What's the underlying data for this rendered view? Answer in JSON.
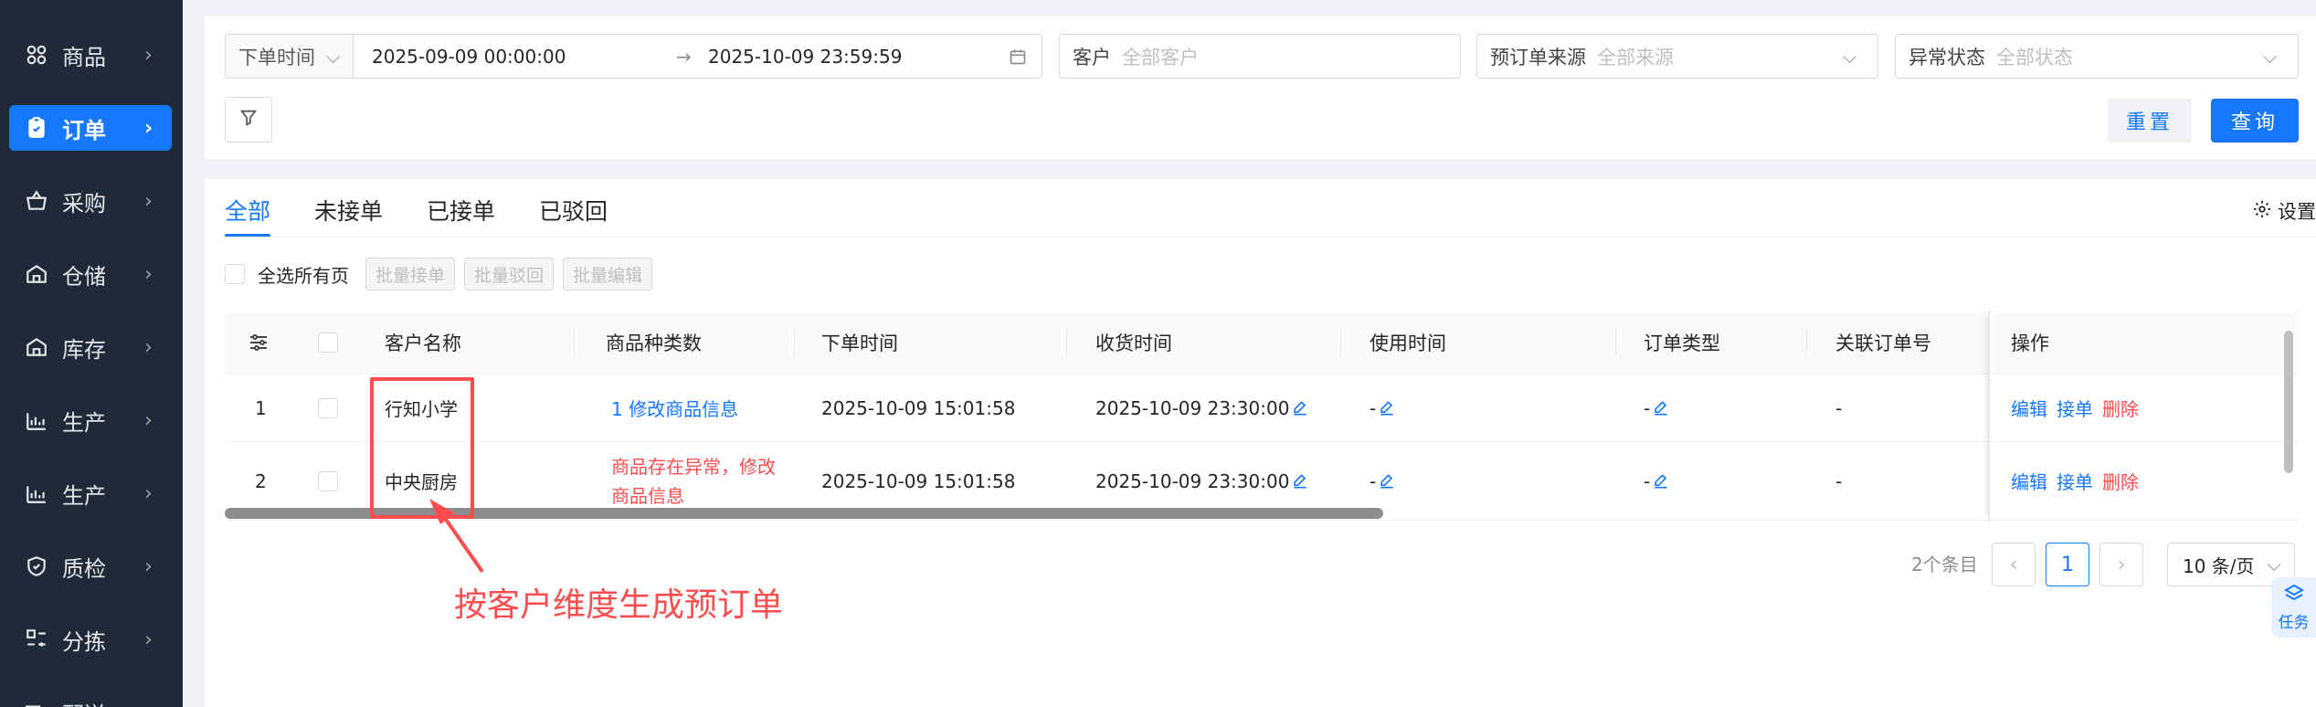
{
  "sidebar": {
    "items": [
      {
        "label": "商品",
        "icon": "grid-icon",
        "active": false
      },
      {
        "label": "订单",
        "icon": "clipboard-icon",
        "active": true
      },
      {
        "label": "采购",
        "icon": "basket-icon",
        "active": false
      },
      {
        "label": "仓储",
        "icon": "warehouse-icon",
        "active": false
      },
      {
        "label": "库存",
        "icon": "warehouse-icon",
        "active": false
      },
      {
        "label": "生产",
        "icon": "factory-icon",
        "active": false
      },
      {
        "label": "生产",
        "icon": "factory-icon",
        "active": false
      },
      {
        "label": "质检",
        "icon": "shield-icon",
        "active": false
      },
      {
        "label": "分拣",
        "icon": "sort-icon",
        "active": false
      },
      {
        "label": "配送",
        "icon": "truck-icon",
        "active": false
      }
    ]
  },
  "filters": {
    "date_type": "下单时间",
    "date_start": "2025-09-09 00:00:00",
    "date_end": "2025-10-09 23:59:59",
    "customer_label": "客户",
    "customer_placeholder": "全部客户",
    "source_label": "预订单来源",
    "source_placeholder": "全部来源",
    "status_label": "异常状态",
    "status_placeholder": "全部状态",
    "reset_label": "重置",
    "query_label": "查询"
  },
  "tabs": [
    "全部",
    "未接单",
    "已接单",
    "已驳回"
  ],
  "settings_label": "设置",
  "bulk": {
    "select_all_label": "全选所有页",
    "accept_label": "批量接单",
    "reject_label": "批量驳回",
    "edit_label": "批量编辑"
  },
  "table": {
    "columns": [
      "客户名称",
      "商品种类数",
      "下单时间",
      "收货时间",
      "使用时间",
      "订单类型",
      "关联订单号",
      "操作"
    ],
    "rows": [
      {
        "index": "1",
        "customer": "行知小学",
        "product_info": "1 修改商品信息",
        "product_info_state": "normal",
        "order_time": "2025-10-09 15:01:58",
        "receive_time": "2025-10-09 23:30:00",
        "use_time": "-",
        "order_type": "-",
        "related_order": "-"
      },
      {
        "index": "2",
        "customer": "中央厨房",
        "product_info": "商品存在异常，修改商品信息",
        "product_info_state": "error",
        "order_time": "2025-10-09 15:01:58",
        "receive_time": "2025-10-09 23:30:00",
        "use_time": "-",
        "order_type": "-",
        "related_order": "-"
      }
    ],
    "actions": {
      "edit": "编辑",
      "accept": "接单",
      "delete": "删除"
    }
  },
  "annotation": "按客户维度生成预订单",
  "pagination": {
    "total": "2个条目",
    "current_page": "1",
    "page_size": "10 条/页"
  },
  "task_float_label": "任务",
  "colors": {
    "primary": "#1677ff",
    "danger": "#ff4d4f",
    "sidebar_bg": "#1f2937"
  }
}
